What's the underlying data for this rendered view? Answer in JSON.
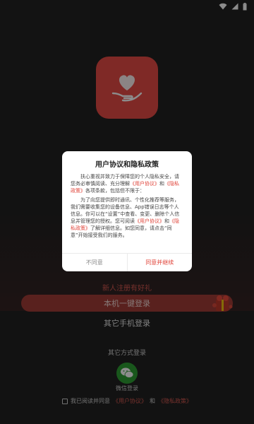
{
  "login": {
    "new_user_gift": "新人注册有好礼",
    "one_key_login": "本机一键登录",
    "other_phone_login": "其它手机登录",
    "other_methods": "其它方式登录",
    "wechat_label": "微信登录",
    "agree_prefix": "我已阅读并同意",
    "agree_link1": "《用户协议》",
    "agree_and": "和",
    "agree_link2": "《隐私政策》"
  },
  "dialog": {
    "title": "用户协议和隐私政策",
    "p1_a": "扶心重视并致力于保障您的个人隐私安全，请您务必审慎阅读、充分理解",
    "p1_link1": "《用户协议》",
    "p1_and": "和",
    "p1_link2": "《隐私政策》",
    "p1_b": "各项条款，包括但不限于：",
    "p2_a": "为了向您提供即时通讯、个性化推荐等服务，我们需要收集您的设备信息、App错误日志等个人信息。你可以在“设置”中查看、变更、删除个人信息并管理您的授权。您可阅读",
    "p2_link1": "《用户协议》",
    "p2_and": "和",
    "p2_link2": "《隐私政策》",
    "p2_b": "了解详细信息。如您同意，请点击“同意”开始接受我们的服务。",
    "disagree": "不同意",
    "agree": "同意并继续"
  },
  "colors": {
    "brand": "#e74c45",
    "link": "#e0443a",
    "wechat": "#2f9e33"
  },
  "icons": {
    "logo": "heart-hand-icon",
    "wechat": "wechat-icon",
    "gift": "gift-icon"
  }
}
